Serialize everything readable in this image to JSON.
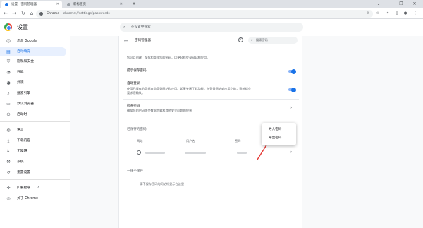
{
  "window": {
    "tabs": [
      {
        "label": "设置 - 密码管理器",
        "active": true,
        "icon": "gear-icon"
      },
      {
        "label": "新标签页",
        "active": false,
        "icon": "globe-icon"
      }
    ],
    "new_tab_symbol": "+",
    "controls": {
      "dropdown": "⌄",
      "minimize": "–",
      "maximize": "❐",
      "close": "✕"
    }
  },
  "toolbar": {
    "origin_label": "Chrome",
    "url": "chrome://settings/passwords"
  },
  "header": {
    "title": "设置",
    "search_placeholder": "在设置中搜索"
  },
  "sidebar": {
    "items": [
      {
        "label": "您与 Google",
        "icon": "person-icon"
      },
      {
        "label": "自动填充",
        "icon": "autofill-icon",
        "active": true
      },
      {
        "label": "隐私和安全",
        "icon": "shield-icon"
      },
      {
        "label": "性能",
        "icon": "speedometer-icon"
      },
      {
        "label": "外观",
        "icon": "palette-icon"
      },
      {
        "label": "搜索引擎",
        "icon": "search-icon"
      },
      {
        "label": "默认浏览器",
        "icon": "browser-icon"
      },
      {
        "label": "启动时",
        "icon": "power-icon"
      },
      {
        "label": "语言",
        "icon": "globe-icon"
      },
      {
        "label": "下载内容",
        "icon": "download-icon"
      },
      {
        "label": "无障碍",
        "icon": "accessibility-icon"
      },
      {
        "label": "系统",
        "icon": "wrench-icon"
      },
      {
        "label": "重置设置",
        "icon": "reset-icon"
      },
      {
        "label": "扩展程序",
        "icon": "puzzle-icon"
      },
      {
        "label": "关于 Chrome",
        "icon": "chrome-icon"
      }
    ]
  },
  "password_manager": {
    "title": "密码管理器",
    "search_placeholder": "搜索密码",
    "intro": "您可以创建、保存和管理您的密码，以便轻松登录网站和应用。",
    "offer_to_save": {
      "label": "提示保存密码",
      "enabled": true
    },
    "auto_signin": {
      "label": "自动登录",
      "desc_line1": "使用已保存的凭据自动登录网站和应用。如果关闭了此功能，在登录网站或应用之前，系统都会",
      "desc_line2": "要求您确认。",
      "enabled": true
    },
    "check_passwords": {
      "label": "检查密码",
      "desc": "确保您的密码免受数据泄露和其他安全问题的侵害"
    },
    "saved_passwords": {
      "heading": "已保存的密码",
      "columns": [
        "网站",
        "用户名",
        "密码"
      ]
    },
    "never_saved": {
      "heading": "一律不保存",
      "empty_text": "一律不保存密码的网站将显示在这里"
    },
    "menu": {
      "items": [
        "导入密码",
        "导出密码"
      ]
    }
  },
  "colors": {
    "accent": "#1a73e8",
    "arrow": "#e53935"
  }
}
